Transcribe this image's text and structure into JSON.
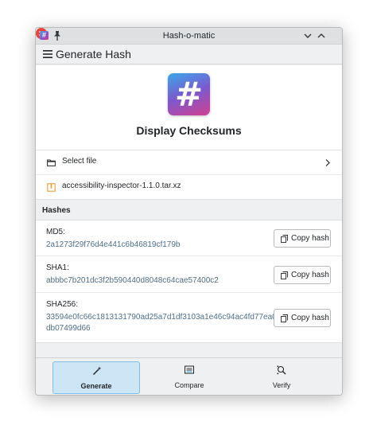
{
  "window": {
    "title": "Hash-o-matic",
    "app_icon_glyph": "#",
    "controls": [
      "pin-icon",
      "minimize-icon",
      "maximize-icon",
      "close-icon"
    ]
  },
  "header": {
    "title": "Generate Hash",
    "menu_icon": "hamburger-icon"
  },
  "hero": {
    "icon_glyph": "#",
    "title": "Display Checksums"
  },
  "file": {
    "select_label": "Select file",
    "select_icon": "folder-icon",
    "selected_name": "accessibility-inspector-1.1.0.tar.xz",
    "selected_icon": "archive-icon"
  },
  "hashes": {
    "section_label": "Hashes",
    "copy_label": "Copy hash",
    "items": [
      {
        "name": "MD5:",
        "value": "2a1273f29f76d4e441c6b46819cf179b"
      },
      {
        "name": "SHA1:",
        "value": "abbbc7b201dc3f2b590440d8048c64cae57400c2"
      },
      {
        "name": "SHA256:",
        "value": "33594e0fc66c1813131790ad25a7d1df3103a1e46c94ac4fd77ea0db07499d66"
      }
    ]
  },
  "nav": {
    "items": [
      {
        "label": "Generate",
        "icon": "magic-wand-icon",
        "active": true
      },
      {
        "label": "Compare",
        "icon": "compare-icon",
        "active": false
      },
      {
        "label": "Verify",
        "icon": "verify-icon",
        "active": false
      }
    ]
  },
  "colors": {
    "accent": "#3daee9",
    "active_tab_bg": "#cde6f5",
    "hash_text": "#4f6f8a",
    "close_button": "#e9433d"
  }
}
